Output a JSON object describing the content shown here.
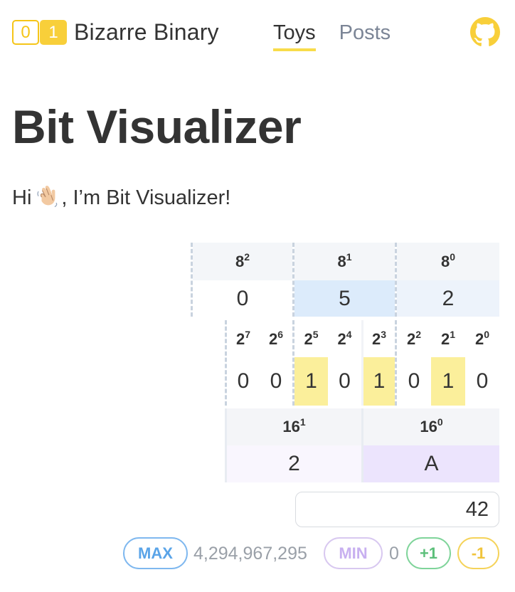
{
  "header": {
    "logo": {
      "bit0": "0",
      "bit1": "1",
      "title": "Bizarre Binary"
    },
    "nav": [
      {
        "label": "Toys",
        "active": true
      },
      {
        "label": "Posts",
        "active": false
      }
    ],
    "github_icon": "github-icon",
    "accent_color": "#f8cf3a"
  },
  "page": {
    "title": "Bit Visualizer",
    "greeting_before": "Hi ",
    "greeting_emoji": "waving-hand-icon",
    "greeting_after": ", I’m Bit Visualizer!"
  },
  "octal": {
    "headers": [
      {
        "base": "8",
        "exp": "2"
      },
      {
        "base": "8",
        "exp": "1"
      },
      {
        "base": "8",
        "exp": "0"
      }
    ],
    "digits": [
      "0",
      "5",
      "2"
    ]
  },
  "binary": {
    "headers": [
      {
        "base": "2",
        "exp": "7"
      },
      {
        "base": "2",
        "exp": "6"
      },
      {
        "base": "2",
        "exp": "5"
      },
      {
        "base": "2",
        "exp": "4"
      },
      {
        "base": "2",
        "exp": "3"
      },
      {
        "base": "2",
        "exp": "2"
      },
      {
        "base": "2",
        "exp": "1"
      },
      {
        "base": "2",
        "exp": "0"
      }
    ],
    "bits": [
      "0",
      "0",
      "1",
      "0",
      "1",
      "0",
      "1",
      "0"
    ]
  },
  "hex": {
    "headers": [
      {
        "base": "16",
        "exp": "1"
      },
      {
        "base": "16",
        "exp": "0"
      }
    ],
    "digits": [
      "2",
      "A"
    ]
  },
  "controls": {
    "value": "42",
    "max_label": "MAX",
    "max_value": "4,294,967,295",
    "min_label": "MIN",
    "min_value": "0",
    "inc_label": "+1",
    "dec_label": "-1"
  }
}
